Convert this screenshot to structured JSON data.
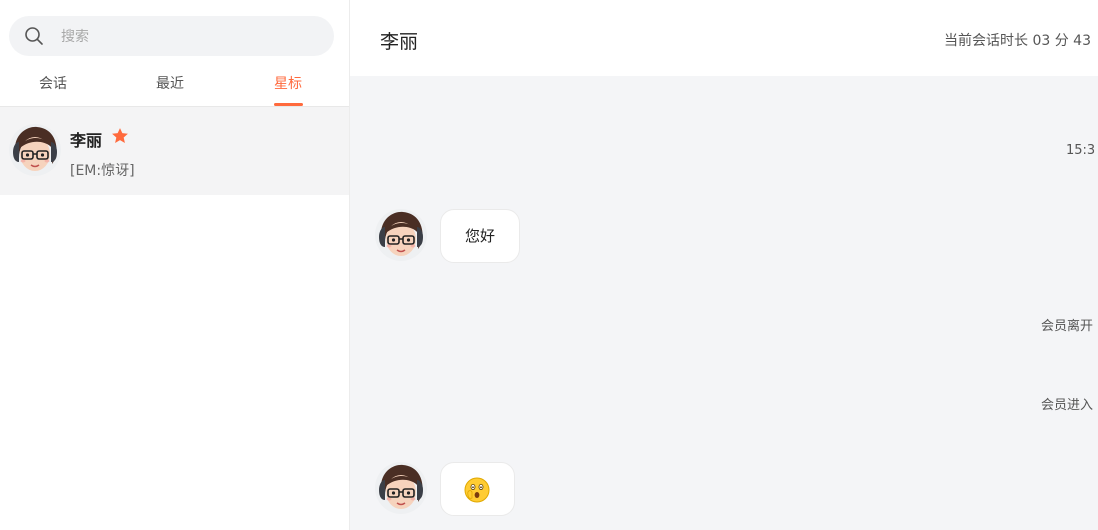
{
  "sidebar": {
    "search": {
      "placeholder": "搜索"
    },
    "tabs": [
      {
        "label": "会话"
      },
      {
        "label": "最近"
      },
      {
        "label": "星标",
        "active": true
      }
    ],
    "conversation": {
      "name": "李丽",
      "preview": "[EM:惊讶]",
      "starred": true
    }
  },
  "header": {
    "title": "李丽",
    "duration": "当前会话时长 03 分 43"
  },
  "chat": {
    "timestamp": "15:3",
    "messages": [
      {
        "text": "您好"
      },
      {
        "emoji": "surprised-emoji"
      }
    ],
    "system": [
      "会员离开",
      "会员进入"
    ]
  },
  "colors": {
    "accent": "#ff6a3d",
    "chat_bg": "#f4f5f7",
    "active_row": "#f4f4f5"
  }
}
